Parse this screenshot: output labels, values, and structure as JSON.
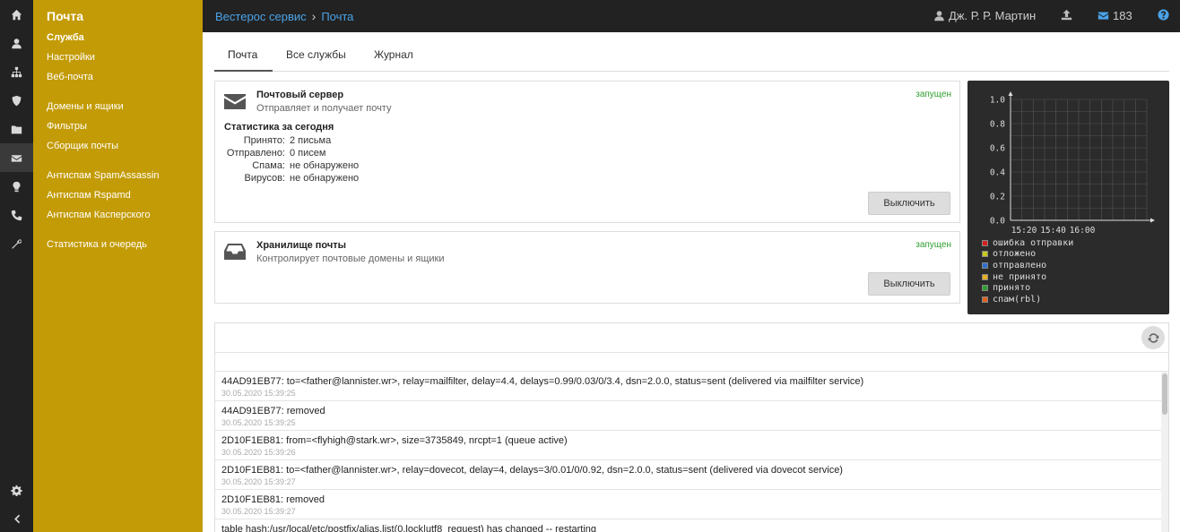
{
  "menu": {
    "title": "Почта",
    "items": [
      {
        "label": "Служба",
        "bold": true
      },
      {
        "label": "Настройки"
      },
      {
        "label": "Веб-почта"
      },
      {
        "label": "Домены и ящики"
      },
      {
        "label": "Фильтры"
      },
      {
        "label": "Сборщик почты"
      },
      {
        "label": "Антиспам SpamAssassin"
      },
      {
        "label": "Антиспам Rspamd"
      },
      {
        "label": "Антиспам Касперского"
      },
      {
        "label": "Статистика и очередь"
      }
    ]
  },
  "header": {
    "breadcrumb": [
      "Вестерос сервис",
      "Почта"
    ],
    "user": "Дж. Р. Р. Мартин",
    "mail_count": "183"
  },
  "tabs": [
    "Почта",
    "Все службы",
    "Журнал"
  ],
  "services": [
    {
      "name": "Почтовый сервер",
      "description": "Отправляет и получает почту",
      "status": "запущен",
      "button": "Выключить",
      "stats_title": "Статистика за сегодня",
      "stats": [
        {
          "key": "Принято:",
          "value": "2 письма"
        },
        {
          "key": "Отправлено:",
          "value": "0 писем"
        },
        {
          "key": "Спама:",
          "value": "не обнаружено"
        },
        {
          "key": "Вирусов:",
          "value": "не обнаружено"
        }
      ]
    },
    {
      "name": "Хранилище почты",
      "description": "Контролирует почтовые домены и ящики",
      "status": "запущен",
      "button": "Выключить"
    }
  ],
  "chart_data": {
    "type": "line",
    "y_ticks": [
      "1.0",
      "0.8",
      "0.6",
      "0.4",
      "0.2",
      "0.0"
    ],
    "x_ticks": [
      "15:20",
      "15:40",
      "16:00"
    ],
    "ylim": [
      0,
      1
    ],
    "grid": true,
    "legend_position": "bottom",
    "series": [
      {
        "name": "ошибка отправки",
        "color": "#d62020",
        "values": []
      },
      {
        "name": "отложено",
        "color": "#c8c820",
        "values": []
      },
      {
        "name": "отправлено",
        "color": "#2f6fd0",
        "values": []
      },
      {
        "name": "не принято",
        "color": "#e8b020",
        "values": []
      },
      {
        "name": "принято",
        "color": "#2fa02f",
        "values": []
      },
      {
        "name": "спам(rbl)",
        "color": "#e06020",
        "values": []
      }
    ]
  },
  "log": [
    {
      "msg": "44AD91EB77: to=<father@lannister.wr>, relay=mailfilter, delay=4.4, delays=0.99/0.03/0/3.4, dsn=2.0.0, status=sent (delivered via mailfilter service)",
      "ts": "30.05.2020 15:39:25"
    },
    {
      "msg": "44AD91EB77: removed",
      "ts": "30.05.2020 15:39:25"
    },
    {
      "msg": "2D10F1EB81: from=<flyhigh@stark.wr>, size=3735849, nrcpt=1 (queue active)",
      "ts": "30.05.2020 15:39:26"
    },
    {
      "msg": "2D10F1EB81: to=<father@lannister.wr>, relay=dovecot, delay=4, delays=3/0.01/0/0.92, dsn=2.0.0, status=sent (delivered via dovecot service)",
      "ts": "30.05.2020 15:39:27"
    },
    {
      "msg": "2D10F1EB81: removed",
      "ts": "30.05.2020 15:39:27"
    },
    {
      "msg": "table hash:/usr/local/etc/postfix/alias.list(0,lock|utf8_request) has changed -- restarting",
      "ts": ""
    }
  ],
  "icons": {
    "rail": [
      "home-icon",
      "user-icon",
      "network-icon",
      "shield-icon",
      "folder-icon",
      "envelope-icon",
      "lightbulb-icon",
      "phone-icon",
      "wrench-icon",
      "gear-icon",
      "chevron-left-icon"
    ]
  }
}
